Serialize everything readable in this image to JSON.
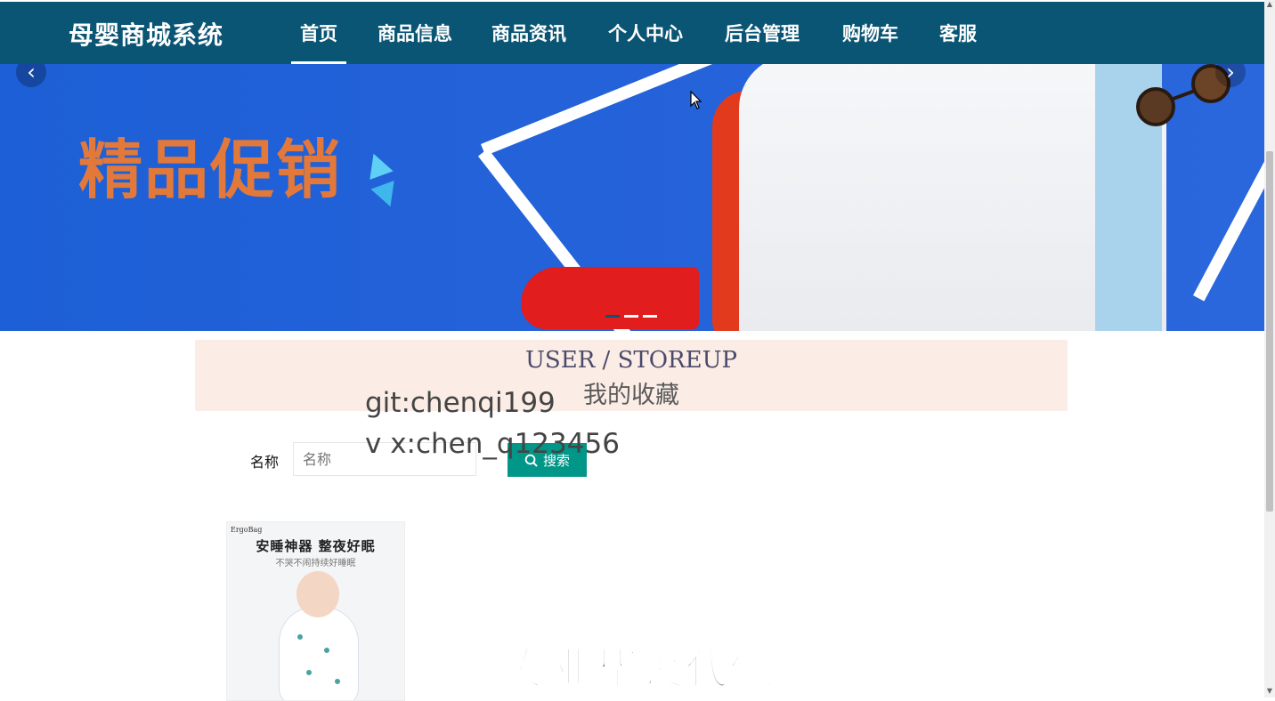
{
  "nav": {
    "logo": "母婴商城系统",
    "items": [
      {
        "label": "首页",
        "active": true
      },
      {
        "label": "商品信息"
      },
      {
        "label": "商品资讯"
      },
      {
        "label": "个人中心"
      },
      {
        "label": "后台管理"
      },
      {
        "label": "购物车"
      },
      {
        "label": "客服"
      }
    ]
  },
  "banner": {
    "text": "精品促销",
    "slides_count": 3,
    "active_slide": 1
  },
  "section": {
    "title_en": "USER / STOREUP",
    "title_cn": "我的收藏"
  },
  "search": {
    "label": "名称",
    "placeholder": "名称",
    "button_label": "搜索"
  },
  "products": [
    {
      "brand": "ErgoBag",
      "headline": "安睡神器 整夜好眠",
      "subline": "不哭不闹持续好睡眠"
    }
  ],
  "watermarks": {
    "line1": "git:chenqi199",
    "line2": "v x:chen_q123456",
    "big": "专业毕设代做"
  },
  "colors": {
    "nav_bg": "#0b5574",
    "button": "#009688",
    "title_bg": "#fbede6",
    "banner_bg": "#2462d9",
    "promo_text": "#e2793a"
  }
}
